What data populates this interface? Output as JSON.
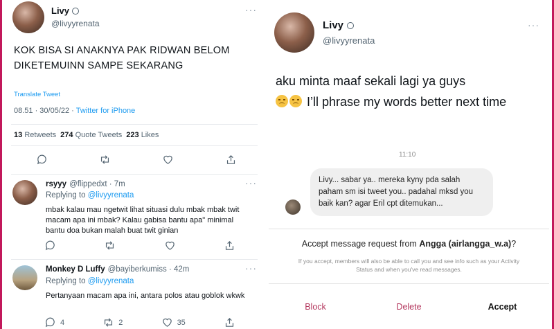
{
  "left": {
    "tweet": {
      "author_name": "Livy",
      "author_handle": "@livyyrenata",
      "text": "KOK BISA SI ANAKNYA PAK RIDWAN BELOM DIKETEMUINN SAMPE SEKARANG",
      "translate": "Translate Tweet",
      "datetime": "08.51 · 30/05/22 · ",
      "source": "Twitter for iPhone",
      "retweets_count": "13",
      "retweets_label": "Retweets",
      "quotes_count": "274",
      "quotes_label": "Quote Tweets",
      "likes_count": "223",
      "likes_label": "Likes"
    },
    "replies": [
      {
        "name": "rsyyy",
        "handle_time": "@flippedxt · 7m",
        "replying_prefix": "Replying to ",
        "replying_to": "@livyyrenata",
        "text": "mbak kalau mau ngetwit lihat situasi dulu mbak mbak twit macam apa ini mbak? Kalau gabisa bantu apa\" minimal bantu doa bukan malah buat twit ginian"
      },
      {
        "name": "Monkey D Luffy",
        "handle_time": "@bayiberkumiss · 42m",
        "replying_prefix": "Replying to ",
        "replying_to": "@livyyrenata",
        "text": "Pertanyaan macam apa ini, antara polos atau goblok wkwk",
        "reply_count": "4",
        "retweet_count": "2",
        "like_count": "35"
      }
    ]
  },
  "right": {
    "author_name": "Livy",
    "author_handle": "@livyyrenata",
    "text_line1": "aku minta maaf sekali lagi ya guys",
    "text_line2": " I’ll phrase my words better next time",
    "dm_time": "11:10",
    "dm_message": "Livy... sabar ya.. mereka kyny pda salah paham sm isi tweet you.. padahal mksd you baik kan? agar Eril cpt ditemukan...",
    "request_prefix": "Accept message request from ",
    "request_from": "Angga (airlangga_w.a)",
    "request_suffix": "?",
    "request_sub": "If you accept, members will also be able to call you and see info such as your Activity Status and when you've read messages.",
    "block_label": "Block",
    "delete_label": "Delete",
    "accept_label": "Accept"
  },
  "icons": [
    "reply-icon",
    "retweet-icon",
    "like-icon",
    "share-icon",
    "verified-icon",
    "more-icon",
    "sad-emoji-icon"
  ],
  "colors": {
    "link": "#1d9bf0",
    "muted": "#536471",
    "danger": "#b3355c",
    "border_accent": "#c2185b"
  }
}
